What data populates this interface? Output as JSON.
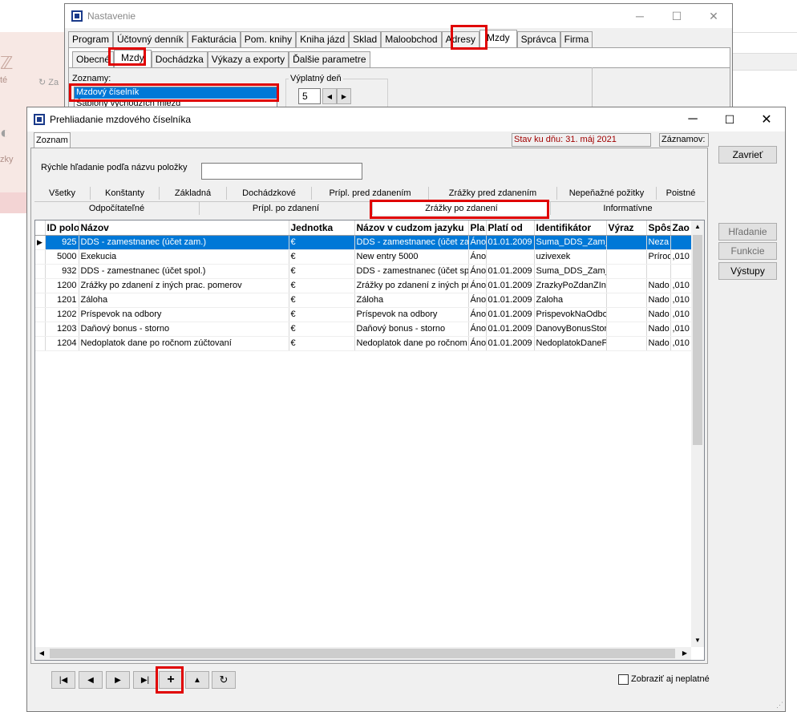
{
  "background_window": {
    "title": "Nastavenie",
    "menu_tabs": [
      "Program",
      "Účtovný denník",
      "Fakturácia",
      "Pom. knihy",
      "Kniha jázd",
      "Sklad",
      "Maloobchod",
      "Adresy",
      "Mzdy",
      "Správca",
      "Firma"
    ],
    "active_menu_tab": "Mzdy",
    "sub_tabs": [
      "Obecné",
      "Mzdy",
      "Dochádzka",
      "Výkazy a exporty",
      "Ďalšie parametre"
    ],
    "active_sub_tab": "Mzdy",
    "zoznamy_label": "Zoznamy:",
    "zoznamy_items": [
      "Mzdový číselník",
      "Šablóny východzích miezd"
    ],
    "vyplatny_den_label": "Výplatný deň",
    "vyplatny_den_value": "5",
    "left_fragments": [
      "té",
      "zky"
    ]
  },
  "main_window": {
    "title": "Prehliadanie mzdového číselníka",
    "tab_label": "Zoznam",
    "status_text": "Stav ku dňu: 31. máj 2021",
    "records_label": "Záznamov:",
    "search_label": "Rýchle hľadanie podľa názvu položky",
    "search_value": "",
    "filter_tabs_row1": [
      "Všetky",
      "Konštanty",
      "Základná",
      "Dochádzkové",
      "Prípl. pred zdanením",
      "Zrážky pred zdanením",
      "Nepeňažné požitky",
      "Poistné"
    ],
    "filter_tabs_row2": [
      "Odpočítateľné",
      "Prípl. po zdanení",
      "Zrážky po zdanení",
      "Informatívne"
    ],
    "active_filter_tab": "Zrážky po zdanení",
    "columns": [
      "ID polo",
      "Názov",
      "Jednotka",
      "Názov v cudzom jazyku",
      "Pla",
      "Platí od",
      "Identifikátor",
      "Výraz",
      "Spôs",
      "Zao"
    ],
    "rows": [
      [
        "925",
        "DDS - zamestnanec (účet zam.)",
        "€",
        "DDS - zamestnanec (účet za",
        "Áno",
        "01.01.2009",
        "Suma_DDS_Zam_",
        "",
        "Neza",
        ""
      ],
      [
        "5000",
        "Exekucia",
        "€",
        "New entry 5000",
        "Áno",
        "",
        "uzivexek",
        "",
        "Prírod",
        ",010"
      ],
      [
        "932",
        "DDS - zamestnanec (účet spol.)",
        "€",
        "DDS - zamestnanec (účet spo",
        "Áno",
        "01.01.2009",
        "Suma_DDS_Zam_",
        "",
        "",
        ""
      ],
      [
        "1200",
        "Zrážky po zdanení z iných prac. pomerov",
        "€",
        "Zrážky po zdanení z iných pra",
        "Áno",
        "01.01.2009",
        "ZrazkyPoZdanZIn",
        "",
        "Nado",
        ",010"
      ],
      [
        "1201",
        "Záloha",
        "€",
        "Záloha",
        "Áno",
        "01.01.2009",
        "Zaloha",
        "",
        "Nado",
        ",010"
      ],
      [
        "1202",
        "Príspevok na odbory",
        "€",
        "Príspevok na odbory",
        "Áno",
        "01.01.2009",
        "PrispevokNaOdbo",
        "",
        "Nado",
        ",010"
      ],
      [
        "1203",
        "Daňový bonus - storno",
        "€",
        "Daňový bonus - storno",
        "Áno",
        "01.01.2009",
        "DanovyBonusStor",
        "",
        "Nado",
        ",010"
      ],
      [
        "1204",
        "Nedoplatok dane po ročnom zúčtovaní",
        "€",
        "Nedoplatok dane po ročnom",
        "Áno",
        "01.01.2009",
        "NedoplatokDaneF",
        "",
        "Nado",
        ",010"
      ]
    ],
    "buttons": {
      "close": "Zavrieť",
      "search": "Hľadanie",
      "functions": "Funkcie",
      "outputs": "Výstupy"
    },
    "show_invalid_label": "Zobraziť aj neplatné"
  }
}
